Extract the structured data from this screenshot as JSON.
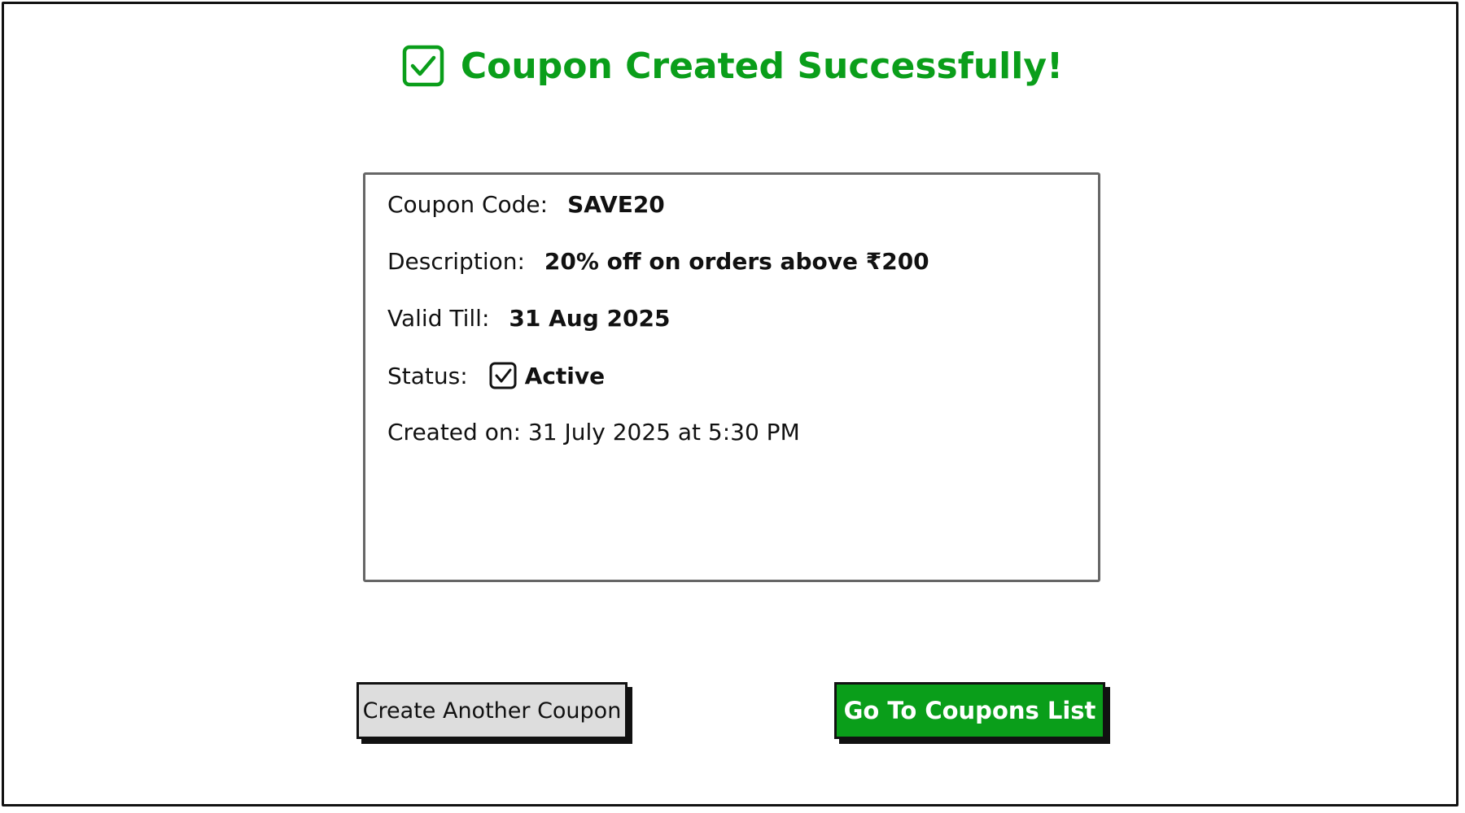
{
  "header": {
    "title": "Coupon Created Successfully!",
    "icon": "checkbox-checked-icon",
    "accent_color": "#0a9e1a"
  },
  "details": {
    "coupon_code_label": "Coupon Code:",
    "coupon_code_value": "SAVE20",
    "description_label": "Description:",
    "description_value": "20% off on orders above ₹200",
    "valid_till_label": "Valid Till:",
    "valid_till_value": "31 Aug 2025",
    "status_label": "Status:",
    "status_icon": "checkbox-checked-icon",
    "status_value": "Active",
    "created_on_text": "Created on: 31 July 2025 at 5:30 PM"
  },
  "actions": {
    "create_another_label": "Create Another Coupon",
    "go_to_list_label": "Go To Coupons List",
    "primary_color": "#0a9e1a",
    "secondary_color": "#dddddd"
  }
}
